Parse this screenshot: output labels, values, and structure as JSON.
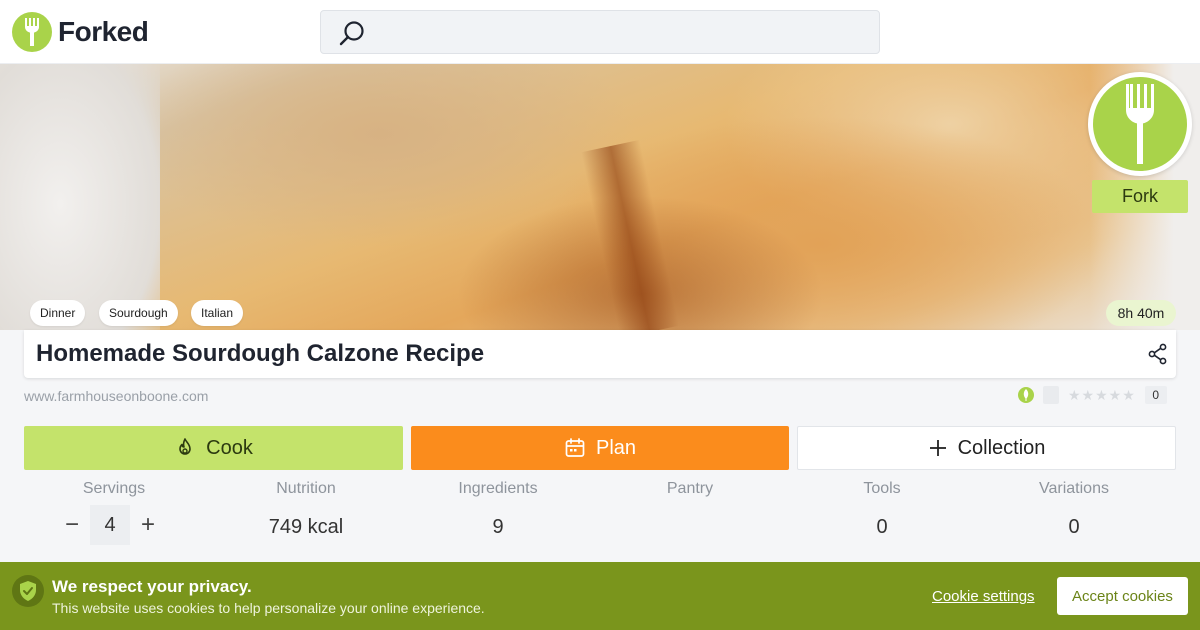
{
  "header": {
    "logo_text": "Forked",
    "search": {
      "placeholder": "",
      "value": ""
    }
  },
  "hero": {
    "fork_label": "Fork",
    "tags": [
      "Dinner",
      "Sourdough",
      "Italian"
    ],
    "total_time": "8h 40m"
  },
  "recipe": {
    "title": "Homemade Sourdough Calzone Recipe",
    "source": "www.farmhouseonboone.com",
    "rating_stars": 0,
    "rating_count": "0"
  },
  "actions": {
    "cook_label": "Cook",
    "plan_label": "Plan",
    "collection_label": "Collection"
  },
  "stats": {
    "servings": {
      "label": "Servings",
      "value": "4",
      "decrement": "−",
      "increment": "+"
    },
    "nutrition": {
      "label": "Nutrition",
      "value": "749 kcal"
    },
    "ingredients": {
      "label": "Ingredients",
      "value": "9"
    },
    "pantry": {
      "label": "Pantry",
      "value": ""
    },
    "tools": {
      "label": "Tools",
      "value": "0"
    },
    "variations": {
      "label": "Variations",
      "value": "0"
    }
  },
  "cookie_banner": {
    "title": "We respect your privacy.",
    "text": "This website uses cookies to help personalize your online experience.",
    "settings_label": "Cookie settings",
    "accept_label": "Accept cookies"
  },
  "colors": {
    "brand_green": "#a9d34a",
    "cook_green": "#c4e36b",
    "plan_orange": "#fb8c1c",
    "banner_green": "#7a951c"
  },
  "icons": [
    "fork-logo-icon",
    "search-icon",
    "fork-icon",
    "share-icon",
    "flame-icon",
    "calendar-icon",
    "plus-icon",
    "shield-check-icon",
    "leaf-icon",
    "star-icon"
  ]
}
